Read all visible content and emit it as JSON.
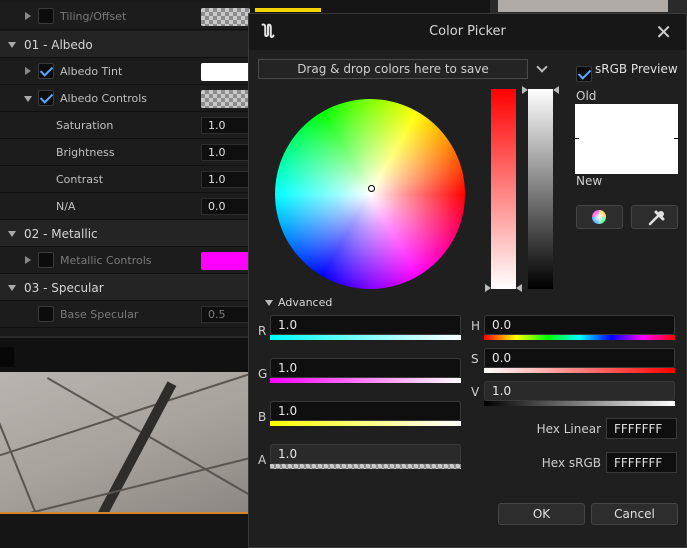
{
  "details_panel": {
    "rows": [
      {
        "kind": "prop",
        "label": "Tiling/Offset",
        "dim": true
      },
      {
        "kind": "cat",
        "label": "01 - Albedo"
      },
      {
        "kind": "prop",
        "label": "Albedo Tint"
      },
      {
        "kind": "prop",
        "label": "Albedo Controls"
      },
      {
        "kind": "sub",
        "label": "Saturation",
        "value": "1.0"
      },
      {
        "kind": "sub",
        "label": "Brightness",
        "value": "1.0"
      },
      {
        "kind": "sub",
        "label": "Contrast",
        "value": "1.0"
      },
      {
        "kind": "sub",
        "label": "N/A",
        "value": "0.0"
      },
      {
        "kind": "cat",
        "label": "02 - Metallic"
      },
      {
        "kind": "prop",
        "label": "Metallic Controls",
        "dim": true
      },
      {
        "kind": "cat",
        "label": "03 - Specular"
      },
      {
        "kind": "prop",
        "label": "Base Specular",
        "value": "0.5",
        "dim": true
      }
    ],
    "albedo_tint_color": "#ffffff",
    "metallic_controls_color": "#ff00ff"
  },
  "dialog": {
    "title": "Color Picker",
    "drop_bar": "Drag & drop colors here to save",
    "srgb_preview": {
      "label": "sRGB Preview",
      "checked": true
    },
    "old_label": "Old",
    "new_label": "New",
    "old_color": "#ffffff",
    "new_color": "#ffffff",
    "advanced_label": "Advanced",
    "channels": {
      "r": {
        "label": "R",
        "value": "1.0"
      },
      "g": {
        "label": "G",
        "value": "1.0"
      },
      "b": {
        "label": "B",
        "value": "1.0"
      },
      "a": {
        "label": "A",
        "value": "1.0"
      }
    },
    "hsv": {
      "h": {
        "label": "H",
        "value": "0.0"
      },
      "s": {
        "label": "S",
        "value": "0.0"
      },
      "v": {
        "label": "V",
        "value": "1.0"
      }
    },
    "hex_linear": {
      "label": "Hex Linear",
      "value": "FFFFFFF"
    },
    "hex_srgb": {
      "label": "Hex sRGB",
      "value": "FFFFFFF"
    },
    "ok_label": "OK",
    "cancel_label": "Cancel",
    "icons": {
      "wheel_mode": "color-wheel-icon",
      "eyedropper": "eyedropper-icon",
      "close": "close-icon"
    }
  }
}
